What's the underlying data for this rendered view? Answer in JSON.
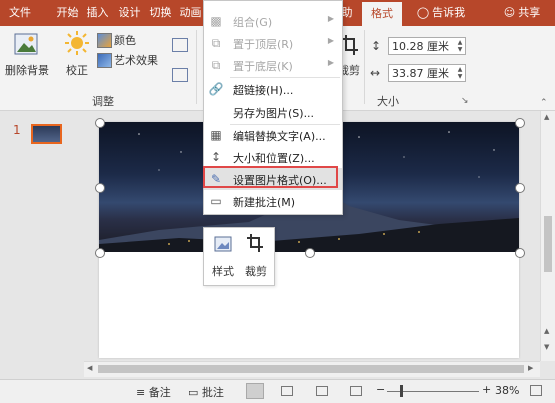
{
  "tabs": [
    {
      "label": "文件",
      "active": false
    },
    {
      "label": "开始",
      "active": false
    },
    {
      "label": "插入",
      "active": false
    },
    {
      "label": "设计",
      "active": false
    },
    {
      "label": "切换",
      "active": false
    },
    {
      "label": "动画",
      "active": false
    },
    {
      "label": "助",
      "active": false
    },
    {
      "label": "格式",
      "active": true
    }
  ],
  "tell_me": "告诉我",
  "share": "共享",
  "ribbon": {
    "remove_bg": "删除背景",
    "correct": "校正",
    "color": "颜色",
    "artistic": "艺术效果",
    "group_adjust": "调整",
    "crop": "裁剪",
    "height": "10.28 厘米",
    "width": "33.87 厘米",
    "group_size": "大小"
  },
  "context_menu": {
    "items": [
      {
        "label": "组合(G)",
        "enabled": false,
        "submenu": true
      },
      {
        "label": "置于顶层(R)",
        "enabled": false,
        "submenu": true
      },
      {
        "label": "置于底层(K)",
        "enabled": false,
        "submenu": true
      },
      {
        "label": "超链接(H)...",
        "enabled": true,
        "submenu": false
      },
      {
        "label": "另存为图片(S)...",
        "enabled": true,
        "submenu": false
      },
      {
        "label": "编辑替换文字(A)...",
        "enabled": true,
        "submenu": false
      },
      {
        "label": "大小和位置(Z)...",
        "enabled": true,
        "submenu": false
      },
      {
        "label": "设置图片格式(O)...",
        "enabled": true,
        "submenu": false,
        "highlighted": true
      },
      {
        "label": "新建批注(M)",
        "enabled": true,
        "submenu": false
      }
    ]
  },
  "mini_toolbar": {
    "style": "样式",
    "crop": "裁剪"
  },
  "slide_thumb_number": "1",
  "status": {
    "notes": "备注",
    "comments": "批注",
    "zoom": "38%"
  },
  "colors": {
    "accent": "#b7472a",
    "highlight_border": "#e04848",
    "thumb_border": "#e8661f"
  }
}
